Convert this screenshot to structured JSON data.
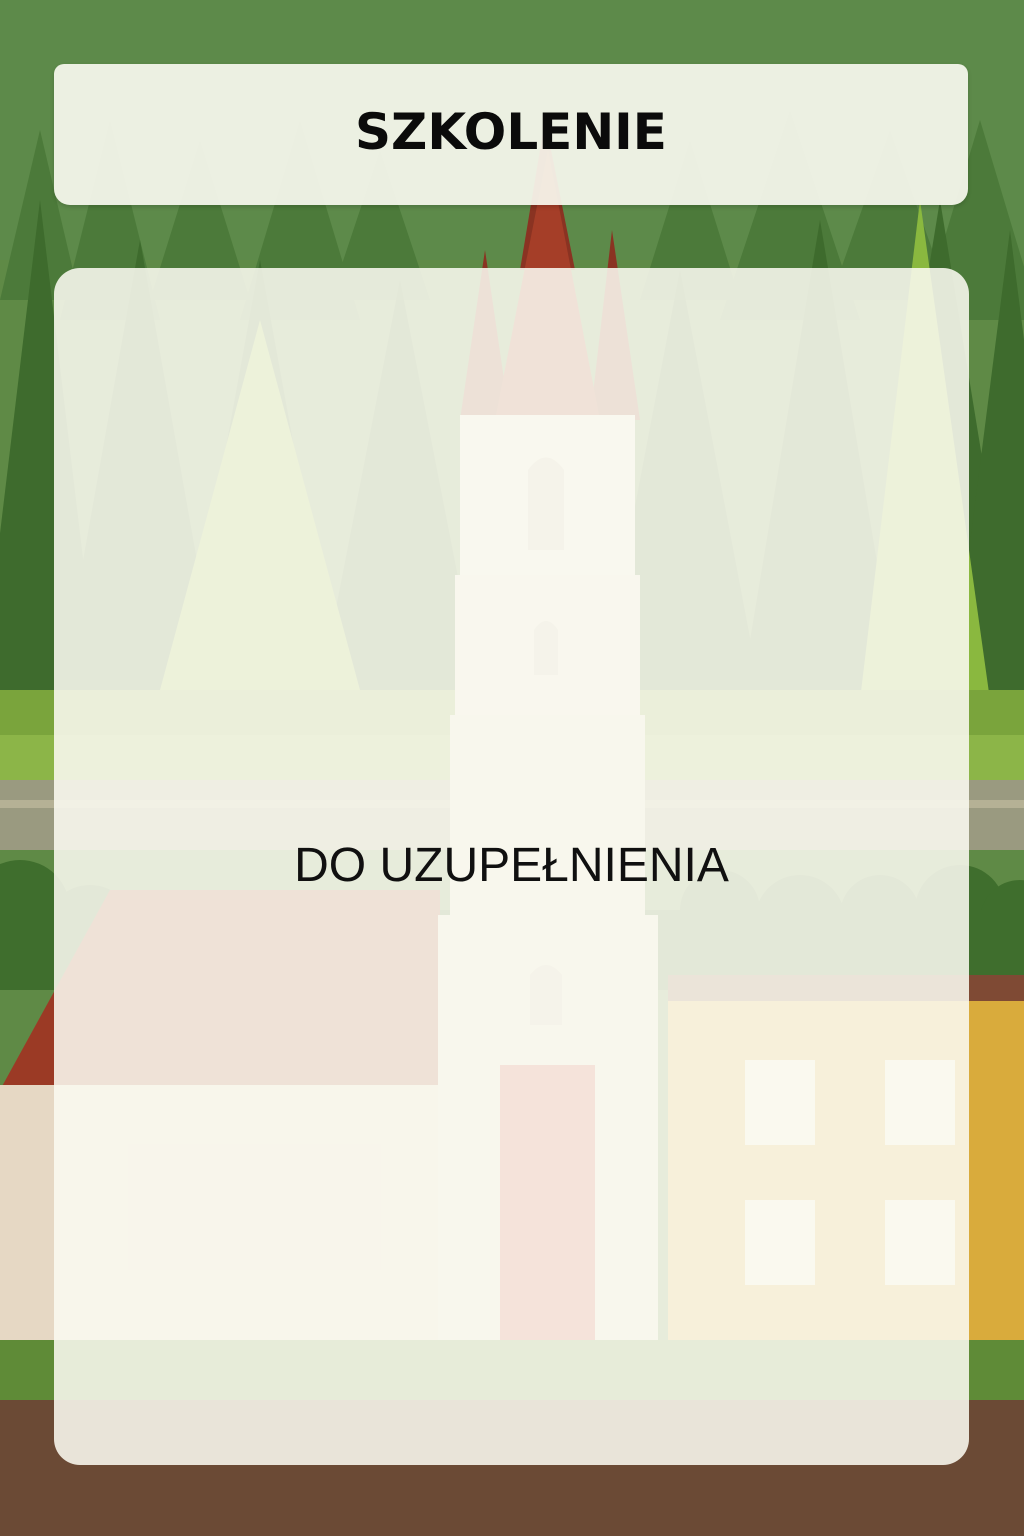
{
  "header": {
    "title": "SZKOLENIE"
  },
  "content": {
    "text": "DO UZUPEŁNIENIA"
  },
  "colors": {
    "forest_dark": "#3f6b2e",
    "forest_light": "#7fae44",
    "ground": "#6b4a35",
    "spire": "#8a3322",
    "building_yellow": "#d9ab3c",
    "panel": "#f8f8ee"
  }
}
